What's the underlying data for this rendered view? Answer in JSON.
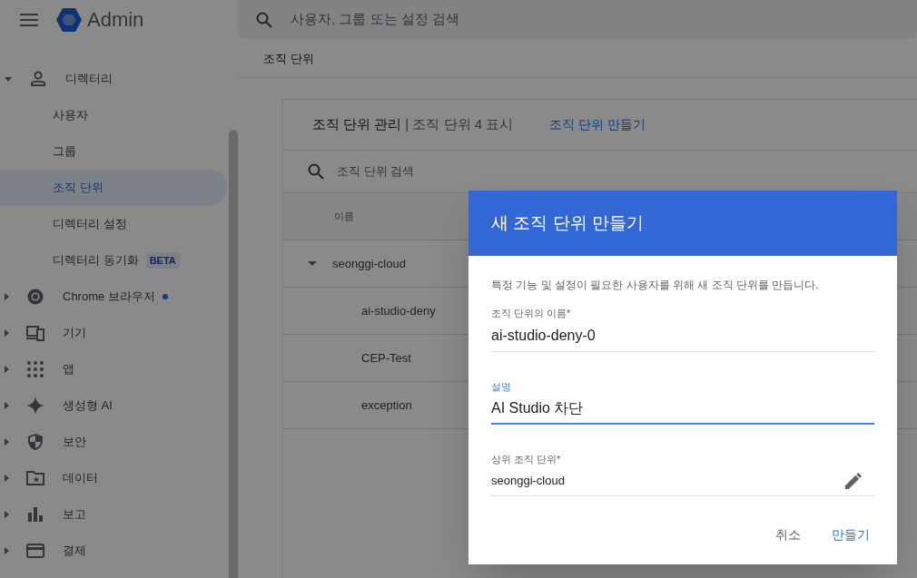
{
  "header": {
    "title": "Admin",
    "search_placeholder": "사용자, 그룹 또는 설정 검색"
  },
  "breadcrumb": "조직 단위",
  "sidebar": {
    "items": [
      {
        "label": "디렉터리",
        "kind": "person",
        "expanded": true,
        "unread": false,
        "children": [
          {
            "label": "사용자",
            "selected": false
          },
          {
            "label": "그룹",
            "selected": false
          },
          {
            "label": "조직 단위",
            "selected": true
          },
          {
            "label": "디렉터리 설정",
            "selected": false
          },
          {
            "label": "디렉터리 동기화",
            "selected": false,
            "badge": "BETA"
          }
        ]
      },
      {
        "label": "Chrome 브라우저",
        "kind": "chrome",
        "expanded": false,
        "unread": true
      },
      {
        "label": "기기",
        "kind": "devices",
        "expanded": false,
        "unread": false
      },
      {
        "label": "앱",
        "kind": "apps",
        "expanded": false,
        "unread": false
      },
      {
        "label": "생성형 AI",
        "kind": "spark",
        "expanded": false,
        "unread": false
      },
      {
        "label": "보안",
        "kind": "shield",
        "expanded": false,
        "unread": false
      },
      {
        "label": "데이터",
        "kind": "folder",
        "expanded": false,
        "unread": false
      },
      {
        "label": "보고",
        "kind": "chart",
        "expanded": false,
        "unread": false
      },
      {
        "label": "결제",
        "kind": "card",
        "expanded": false,
        "unread": false
      }
    ]
  },
  "card": {
    "title": "조직 단위 관리",
    "count": "| 조직 단위 4 표시",
    "create_link": "조직 단위 만들기",
    "search_placeholder": "조직 단위 검색",
    "column": "이름",
    "rows": [
      {
        "name": "seonggi-cloud",
        "expanded": true,
        "children": [
          {
            "name": "ai-studio-deny"
          },
          {
            "name": "CEP-Test"
          },
          {
            "name": "exception"
          }
        ]
      }
    ]
  },
  "dialog": {
    "title": "새 조직 단위 만들기",
    "description": "특정 기능 및 설정이 필요한 사용자를 위해 새 조직 단위를 만듭니다.",
    "fields": [
      {
        "kind": "text",
        "label": "조직 단위의 이름*",
        "value": "ai-studio-deny-0",
        "focused": false
      },
      {
        "kind": "text",
        "label": "설명",
        "value": "AI Studio 차단",
        "focused": true
      },
      {
        "kind": "picker",
        "label": "상위 조직 단위*",
        "value": "seonggi-cloud",
        "focused": false
      }
    ],
    "buttons": [
      {
        "label": "취소",
        "kind": "secondary"
      },
      {
        "label": "만들기",
        "kind": "primary"
      }
    ]
  }
}
